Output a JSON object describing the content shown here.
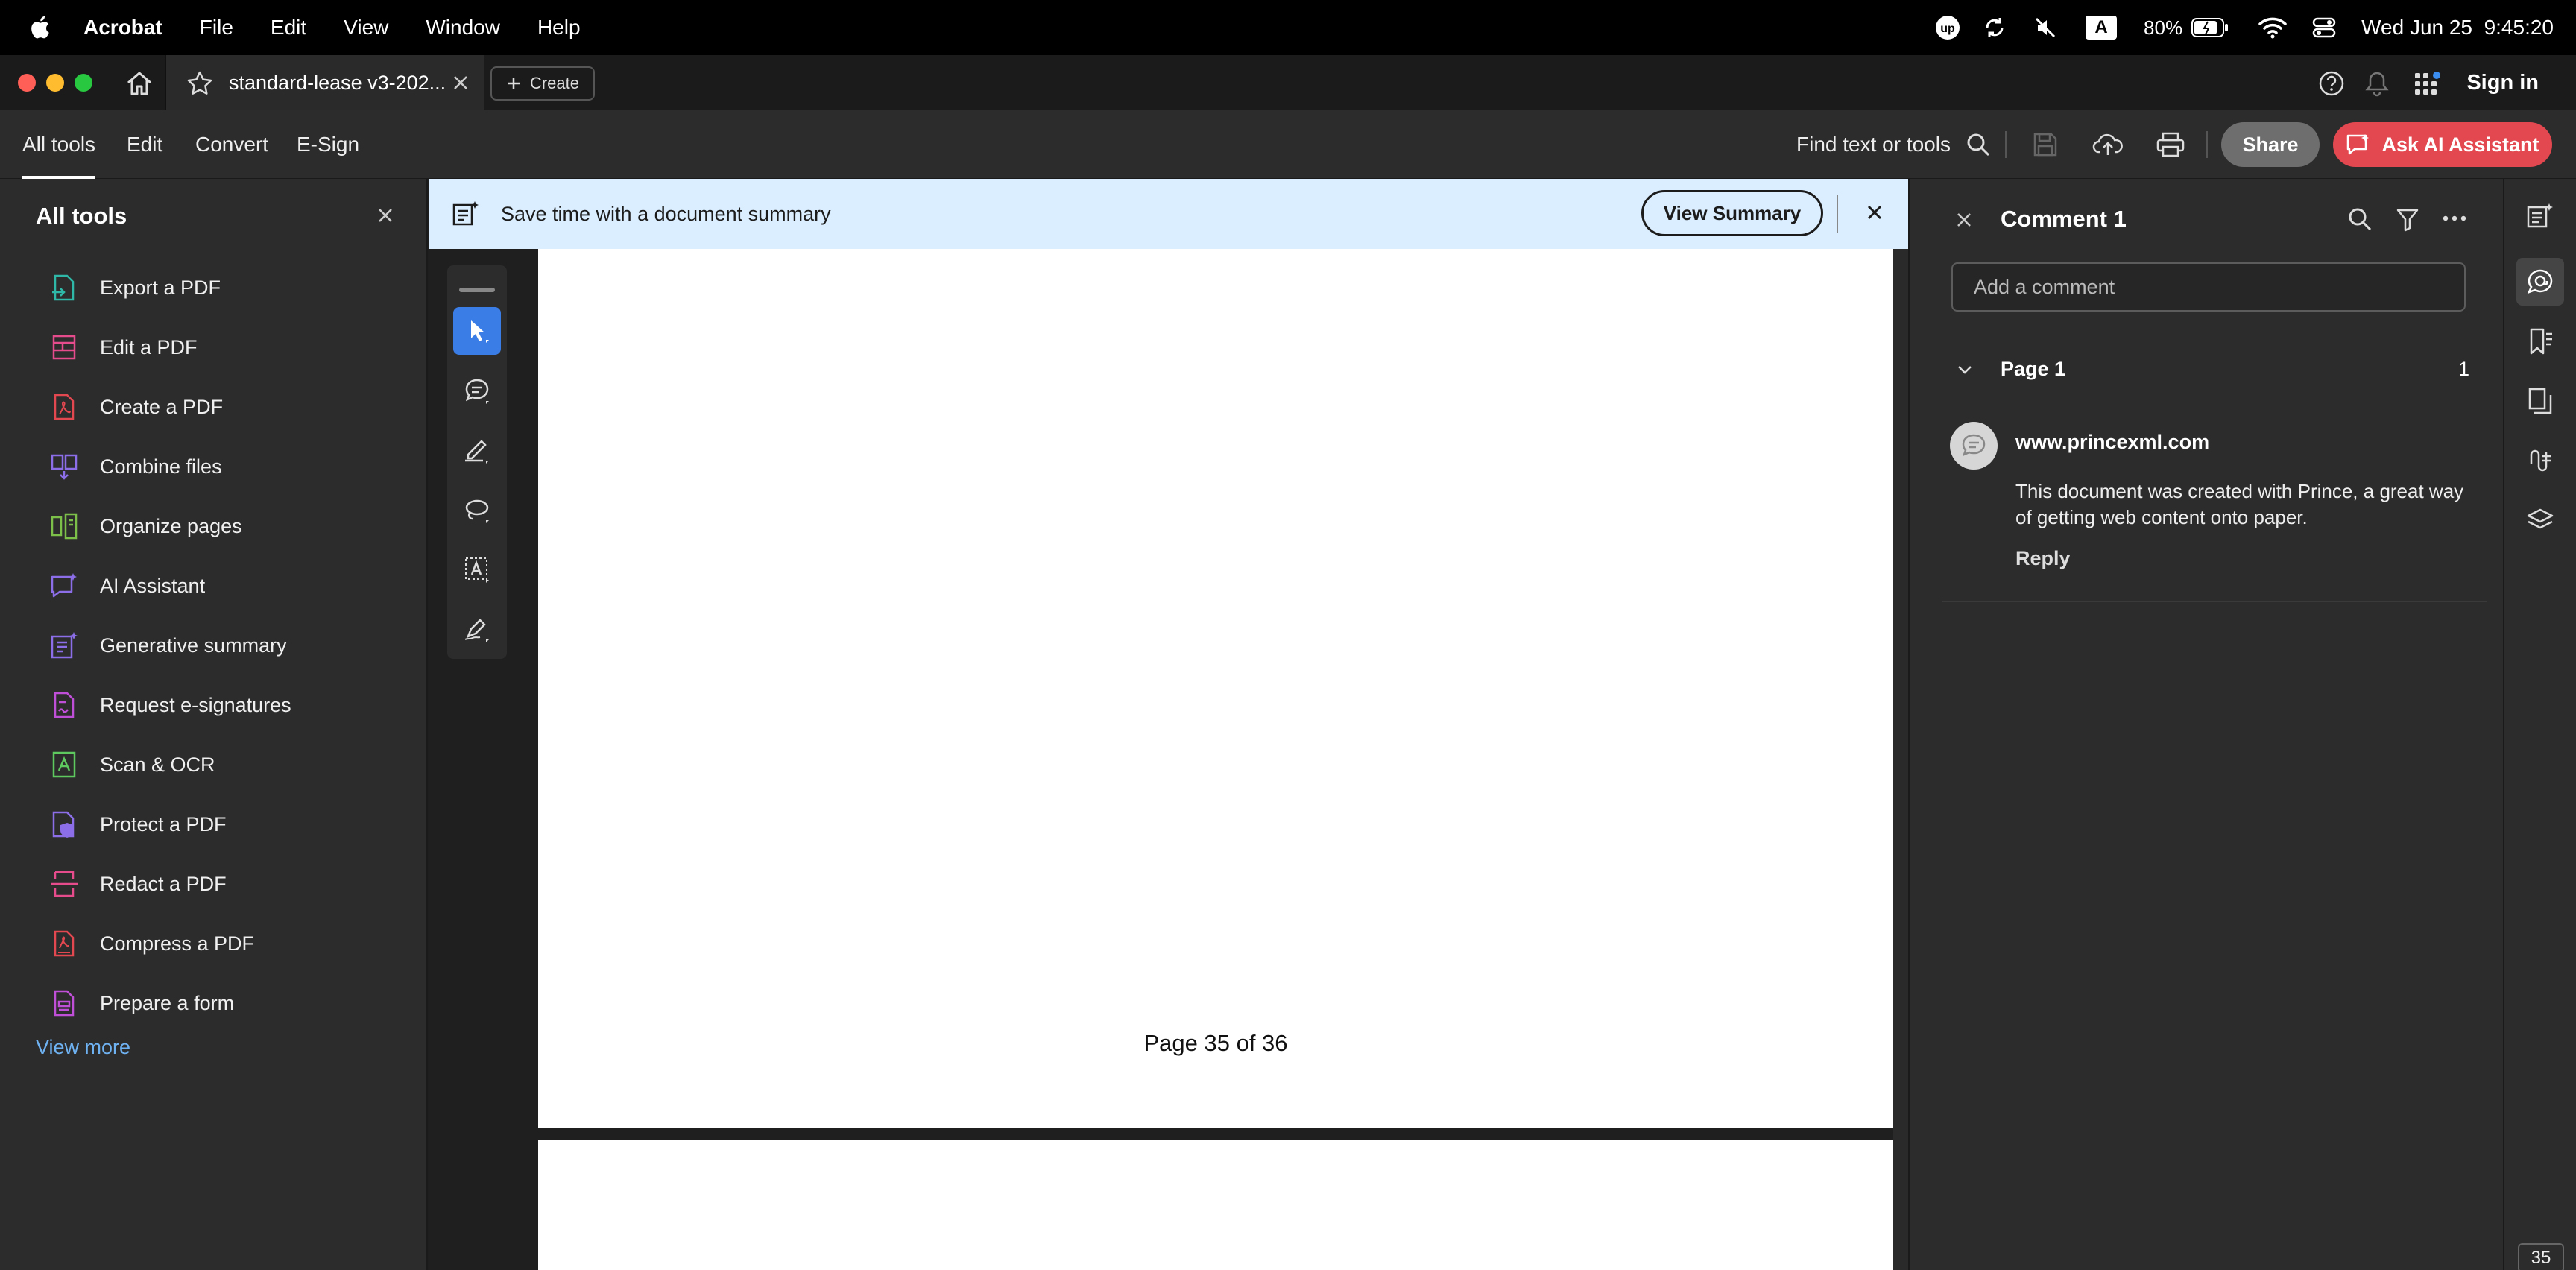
{
  "menubar": {
    "app_name": "Acrobat",
    "items": [
      "File",
      "Edit",
      "View",
      "Window",
      "Help"
    ],
    "battery": "80%",
    "datetime": "Wed Jun 25  9:45:20",
    "input_source": "A"
  },
  "tabbar": {
    "doc_tab_title": "standard-lease v3-202...",
    "create_label": "Create",
    "signin_label": "Sign in"
  },
  "toolbar": {
    "tabs": [
      "All tools",
      "Edit",
      "Convert",
      "E-Sign"
    ],
    "find_label": "Find text or tools",
    "share_label": "Share",
    "ai_label": "Ask AI Assistant"
  },
  "left_panel": {
    "title": "All tools",
    "items": [
      {
        "label": "Export a PDF",
        "icon": "export-pdf-icon",
        "color": "#2fb8a8"
      },
      {
        "label": "Edit a PDF",
        "icon": "edit-pdf-icon",
        "color": "#e64c8c"
      },
      {
        "label": "Create a PDF",
        "icon": "create-pdf-icon",
        "color": "#e34850"
      },
      {
        "label": "Combine files",
        "icon": "combine-files-icon",
        "color": "#8c6fe8"
      },
      {
        "label": "Organize pages",
        "icon": "organize-pages-icon",
        "color": "#7cc04a"
      },
      {
        "label": "AI Assistant",
        "icon": "ai-assistant-icon",
        "color": "#8c6fe8"
      },
      {
        "label": "Generative summary",
        "icon": "generative-summary-icon",
        "color": "#8c6fe8"
      },
      {
        "label": "Request e-signatures",
        "icon": "request-esign-icon",
        "color": "#c04fd8"
      },
      {
        "label": "Scan & OCR",
        "icon": "scan-ocr-icon",
        "color": "#5ec95e"
      },
      {
        "label": "Protect a PDF",
        "icon": "protect-pdf-icon",
        "color": "#8c6fe8"
      },
      {
        "label": "Redact a PDF",
        "icon": "redact-pdf-icon",
        "color": "#e64c8c"
      },
      {
        "label": "Compress a PDF",
        "icon": "compress-pdf-icon",
        "color": "#e34850"
      },
      {
        "label": "Prepare a form",
        "icon": "prepare-form-icon",
        "color": "#c04fd8"
      }
    ],
    "view_more": "View more"
  },
  "banner": {
    "text": "Save time with a document summary",
    "button": "View Summary"
  },
  "document": {
    "page_footer": "Page 35 of 36"
  },
  "comments": {
    "title": "Comment 1",
    "input_placeholder": "Add a comment",
    "group_label": "Page 1",
    "group_count": "1",
    "author": "www.princexml.com",
    "body": "This document was created with Prince, a great way of getting web content onto paper.",
    "reply_label": "Reply"
  },
  "rail": {
    "page_badge": "35"
  },
  "colors": {
    "accent_blue": "#3b7de6",
    "ai_red": "#e34850",
    "banner_bg": "#dbeeff",
    "link_blue": "#6fb2f2"
  }
}
